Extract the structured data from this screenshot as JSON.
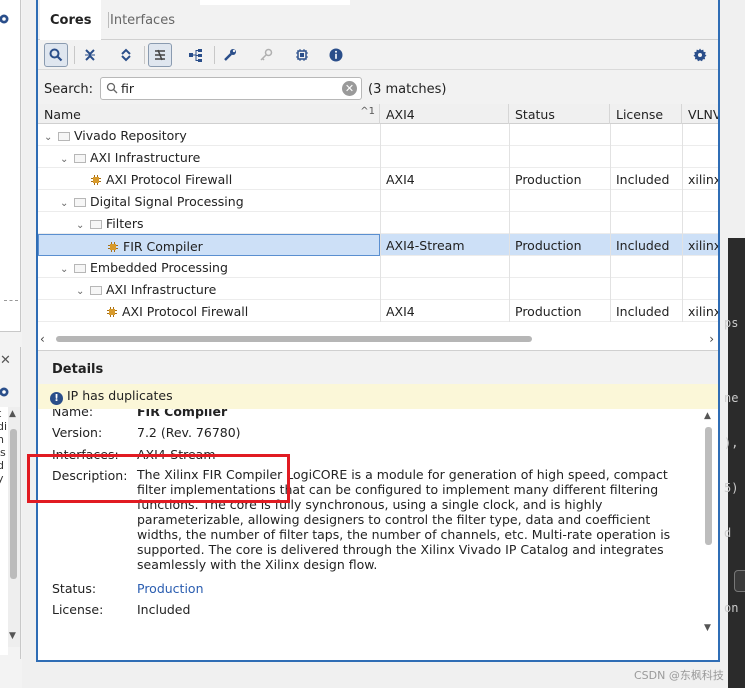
{
  "tabs": [
    {
      "label": "Cores",
      "active": true
    },
    {
      "label": "Interfaces",
      "active": false
    }
  ],
  "toolbar_icons": [
    "search-icon",
    "collapse-all-icon",
    "expand-all-icon",
    "filter-icon",
    "hierarchy-icon",
    "wrench-icon",
    "key-icon",
    "chip-icon",
    "info-icon",
    "gear-icon"
  ],
  "search": {
    "label": "Search:",
    "value": "fir",
    "matches": "(3 matches)"
  },
  "grid": {
    "columns": [
      {
        "label": "Name",
        "sort": "^1"
      },
      {
        "label": "AXI4"
      },
      {
        "label": "Status"
      },
      {
        "label": "License"
      },
      {
        "label": "VLNV"
      }
    ],
    "rows": [
      {
        "level": 0,
        "type": "folder",
        "expanded": true,
        "name": "Vivado Repository",
        "axi": "",
        "status": "",
        "license": "",
        "vlnv": ""
      },
      {
        "level": 1,
        "type": "folder",
        "expanded": true,
        "name": "AXI Infrastructure",
        "axi": "",
        "status": "",
        "license": "",
        "vlnv": ""
      },
      {
        "level": 2,
        "type": "ip",
        "name": "AXI Protocol Firewall",
        "axi": "AXI4",
        "status": "Production",
        "license": "Included",
        "vlnv": "xilinx"
      },
      {
        "level": 1,
        "type": "folder",
        "expanded": true,
        "name": "Digital Signal Processing",
        "axi": "",
        "status": "",
        "license": "",
        "vlnv": ""
      },
      {
        "level": 2,
        "type": "folder",
        "expanded": true,
        "name": "Filters",
        "axi": "",
        "status": "",
        "license": "",
        "vlnv": ""
      },
      {
        "level": 3,
        "type": "ip",
        "name": "FIR Compiler",
        "axi": "AXI4-Stream",
        "status": "Production",
        "license": "Included",
        "vlnv": "xilinx",
        "selected": true
      },
      {
        "level": 1,
        "type": "folder",
        "expanded": true,
        "name": "Embedded Processing",
        "axi": "",
        "status": "",
        "license": "",
        "vlnv": ""
      },
      {
        "level": 2,
        "type": "folder",
        "expanded": true,
        "name": "AXI Infrastructure",
        "axi": "",
        "status": "",
        "license": "",
        "vlnv": ""
      },
      {
        "level": 3,
        "type": "ip",
        "name": "AXI Protocol Firewall",
        "axi": "AXI4",
        "status": "Production",
        "license": "Included",
        "vlnv": "xilinx"
      }
    ]
  },
  "details": {
    "title": "Details",
    "warning": "IP has duplicates",
    "name_label": "Name:",
    "name_value": "FIR Compiler",
    "version_label": "Version:",
    "version_value": "7.2 (Rev. 76780)",
    "interfaces_label": "Interfaces:",
    "interfaces_value": "AXI4-Stream",
    "description_label": "Description:",
    "description_value": "The Xilinx FIR Compiler LogiCORE is a module for generation of high speed, compact filter implementations that can be configured to implement many different filtering functions. The core is fully synchronous, using a single clock, and is highly parameterizable, allowing designers to control the filter type, data and coefficient widths, the number of filter taps, the number of channels, etc. Multi-rate operation is supported. The core is delivered through the Xilinx Vivado IP Catalog and integrates seamlessly with the Xilinx design flow.",
    "status_label": "Status:",
    "status_value": "Production",
    "license_label": "License:",
    "license_value": "Included"
  },
  "colors": {
    "accent": "#2f6db5",
    "highlight_box": "#e11b22",
    "selection": "#cde0f7",
    "warning_bg": "#fbf7d8",
    "link": "#2a5db0"
  },
  "background_fragments": {
    "left_pane_text": [
      "t",
      "",
      "di",
      "n",
      "is",
      "d",
      "",
      "y"
    ],
    "right_code_text": [
      "ps",
      "",
      "ne",
      "),",
      "5)",
      "d",
      "",
      "on"
    ]
  },
  "watermark": "CSDN @东枫科技"
}
